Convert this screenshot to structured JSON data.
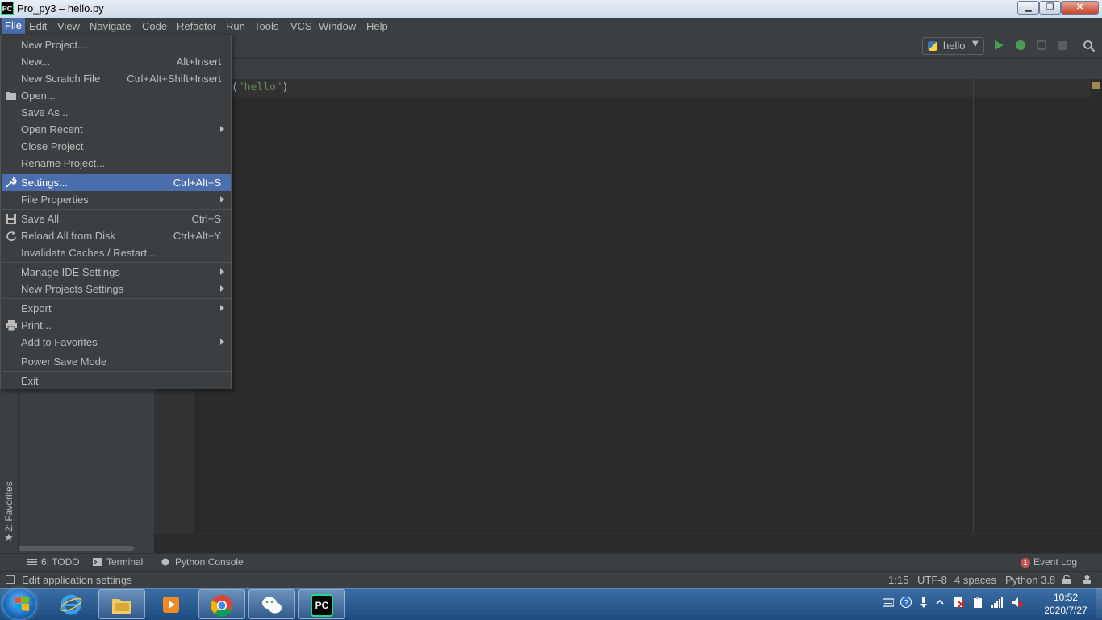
{
  "window": {
    "title": "Pro_py3 – hello.py",
    "app_icon_text": "PC",
    "minimize": "▁",
    "maximize": "❐",
    "close": "✕"
  },
  "menubar": {
    "items": [
      "File",
      "Edit",
      "View",
      "Navigate",
      "Code",
      "Refactor",
      "Run",
      "Tools",
      "VCS",
      "Window",
      "Help"
    ]
  },
  "toolbar": {
    "run_config": "hello",
    "run_config_arrow": "▼"
  },
  "editor": {
    "visible_code_prefix": "(",
    "visible_code_string": "\"hello\"",
    "visible_code_suffix": ")"
  },
  "file_menu": {
    "items": [
      {
        "label": "New Project...",
        "shortcut": ""
      },
      {
        "label": "New...",
        "shortcut": "Alt+Insert"
      },
      {
        "label": "New Scratch File",
        "shortcut": "Ctrl+Alt+Shift+Insert"
      },
      {
        "label": "Open...",
        "shortcut": ""
      },
      {
        "label": "Save As...",
        "shortcut": ""
      },
      {
        "label": "Open Recent",
        "shortcut": ""
      },
      {
        "label": "Close Project",
        "shortcut": ""
      },
      {
        "label": "Rename Project...",
        "shortcut": ""
      },
      {
        "label": "Settings...",
        "shortcut": "Ctrl+Alt+S"
      },
      {
        "label": "File Properties",
        "shortcut": ""
      },
      {
        "label": "Save All",
        "shortcut": "Ctrl+S"
      },
      {
        "label": "Reload All from Disk",
        "shortcut": "Ctrl+Alt+Y"
      },
      {
        "label": "Invalidate Caches / Restart...",
        "shortcut": ""
      },
      {
        "label": "Manage IDE Settings",
        "shortcut": ""
      },
      {
        "label": "New Projects Settings",
        "shortcut": ""
      },
      {
        "label": "Export",
        "shortcut": ""
      },
      {
        "label": "Print...",
        "shortcut": ""
      },
      {
        "label": "Add to Favorites",
        "shortcut": ""
      },
      {
        "label": "Power Save Mode",
        "shortcut": ""
      },
      {
        "label": "Exit",
        "shortcut": ""
      }
    ],
    "selected": "Settings..."
  },
  "left_strip": {
    "favorites": "2: Favorites",
    "favorites_star": "★"
  },
  "bottom_tools": {
    "todo": "6: TODO",
    "terminal": "Terminal",
    "python_console": "Python Console",
    "event_log": "Event Log",
    "event_log_count": "1"
  },
  "statusbar": {
    "message": "Edit application settings",
    "position": "1:15",
    "encoding": "UTF-8",
    "indent": "4 spaces",
    "interpreter": "Python 3.8"
  },
  "taskbar": {
    "time": "10:52",
    "date": "2020/7/27",
    "pycharm_label": "PC"
  },
  "colors": {
    "menu_selection": "#4b6eaf",
    "editor_bg": "#2b2b2b",
    "panel_bg": "#3c3f41",
    "string_green": "#6a8759",
    "run_green": "#499c54"
  }
}
